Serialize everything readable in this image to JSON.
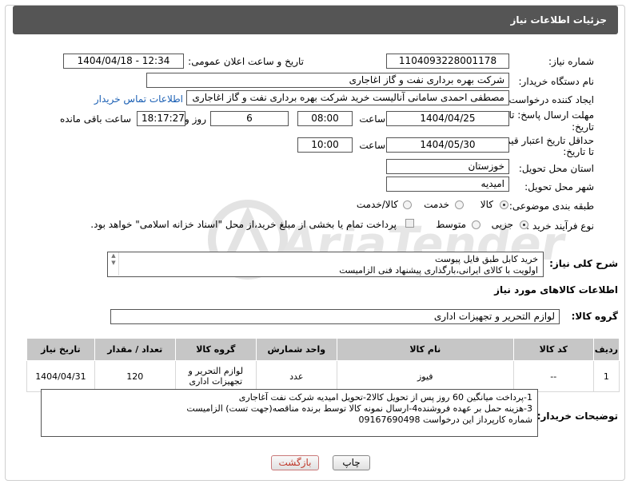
{
  "header": {
    "title": "جزئیات اطلاعات نیاز"
  },
  "need_number": {
    "label": "شماره نیاز:",
    "value": "1104093228001178"
  },
  "announce_datetime": {
    "label": "تاریخ و ساعت اعلان عمومی:",
    "value": "1404/04/18 - 12:34"
  },
  "buyer_org": {
    "label": "نام دستگاه خریدار:",
    "value": "شرکت بهره برداری نفت و گاز اغاجاری"
  },
  "requester": {
    "label": "ایجاد کننده درخواست:",
    "value": "مصطفی احمدی سامانی آنالیست خرید شرکت بهره برداری نفت و گاز اغاجاری",
    "contact_link": "اطلاعات تماس خریدار"
  },
  "deadline": {
    "label_line1": "مهلت ارسال پاسخ: تا",
    "label_line2": "تاریخ:",
    "date": "1404/04/25",
    "time_label": "ساعت",
    "time": "08:00",
    "days": "6",
    "days_label": "روز و",
    "remaining": "18:17:27",
    "remaining_label": "ساعت باقی مانده"
  },
  "price_validity": {
    "label_line1": "حداقل تاریخ اعتبار قیمت:",
    "label_line2": "تا تاریخ:",
    "date": "1404/05/30",
    "time_label": "ساعت",
    "time": "10:00"
  },
  "province": {
    "label": "استان محل تحویل:",
    "value": "خوزستان"
  },
  "city": {
    "label": "شهر محل تحویل:",
    "value": "امیدیه"
  },
  "category": {
    "label": "طبقه بندی موضوعی:",
    "options": [
      "کالا",
      "خدمت",
      "کالا/خدمت"
    ],
    "selected": "کالا"
  },
  "process": {
    "label": "نوع فرآیند خرید :",
    "options": [
      "جزیی",
      "متوسط"
    ],
    "selected": "جزیی",
    "payment_note": "پرداخت تمام یا بخشی از مبلغ خرید،از محل \"اسناد خزانه اسلامی\" خواهد بود."
  },
  "general_desc": {
    "label": "شرح کلی نیاز:",
    "lines": [
      "خرید کابل طبق فایل پیوست",
      "اولویت با کالای ایرانی،بارگذاری پیشنهاد فنی الزامیست"
    ]
  },
  "goods_info": {
    "title": "اطلاعات کالاهای مورد نیاز"
  },
  "goods_group": {
    "label": "گروه کالا:",
    "value": "لوازم التحریر و تجهیزات اداری"
  },
  "table": {
    "headers": [
      "ردیف",
      "کد کالا",
      "نام کالا",
      "واحد شمارش",
      "گروه کالا",
      "تعداد / مقدار",
      "تاریخ نیاز"
    ],
    "rows": [
      [
        "1",
        "--",
        "فیوز",
        "عدد",
        "لوازم التحریر و تجهیزات اداری",
        "120",
        "1404/04/31"
      ]
    ]
  },
  "buyer_notes": {
    "label": "توضیحات خریدار:",
    "lines": [
      "1-پرداخت میانگین 60 روز پس از تحویل کالا2-تحویل امیدیه شرکت نفت آغاجاری",
      "3-هزینه حمل بر عهده فروشنده4-ارسال نمونه کالا توسط برنده مناقصه(جهت تست) الزامیست",
      "شماره کارپرداز این درخواست 09167690498"
    ]
  },
  "buttons": {
    "print": "چاپ",
    "back": "بازگشت"
  },
  "colors": {
    "header_bg": "#555555",
    "link": "#1a5fb4",
    "table_header_bg": "#c6c6c6",
    "back_text": "#c0392b"
  }
}
